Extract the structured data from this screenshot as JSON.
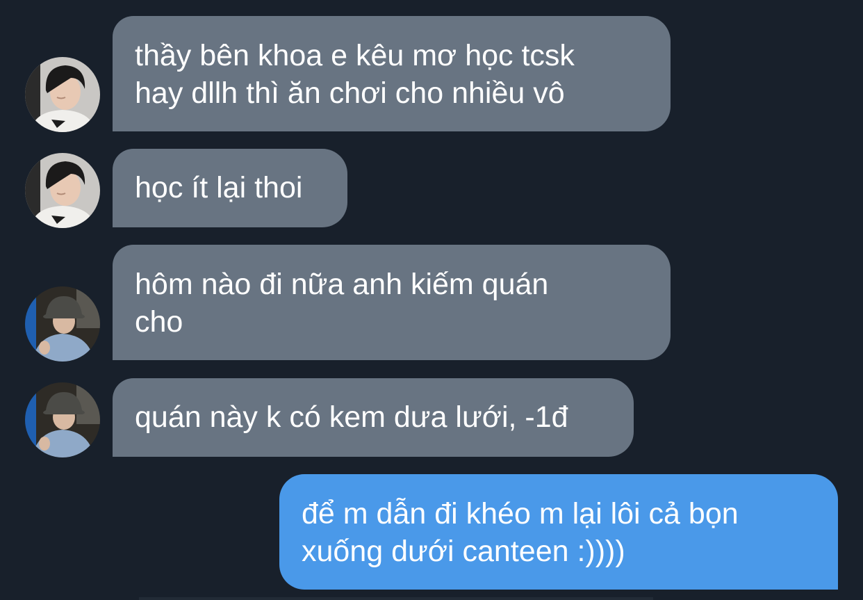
{
  "conversation": {
    "messages": [
      {
        "direction": "incoming",
        "sender_avatar": "profile-photo-boy-dark-hair",
        "text": "thầy bên khoa e kêu mơ học tcsk\nhay dllh thì ăn chơi cho nhiều vô"
      },
      {
        "direction": "incoming",
        "sender_avatar": "profile-photo-boy-dark-hair",
        "text": "học ít lại thoi"
      },
      {
        "direction": "incoming",
        "sender_avatar": "profile-photo-bucket-hat",
        "text": "hôm nào đi nữa anh kiếm quán\ncho"
      },
      {
        "direction": "incoming",
        "sender_avatar": "profile-photo-bucket-hat",
        "text": "quán này k có kem dưa lưới, -1đ"
      },
      {
        "direction": "outgoing",
        "text": "để m dẫn đi khéo m lại lôi cả bọn\nxuống dưới canteen :))))"
      }
    ]
  },
  "colors": {
    "background": "#18202b",
    "incoming_bubble": "#687482",
    "outgoing_bubble": "#4a99e9",
    "text": "#ffffff"
  }
}
